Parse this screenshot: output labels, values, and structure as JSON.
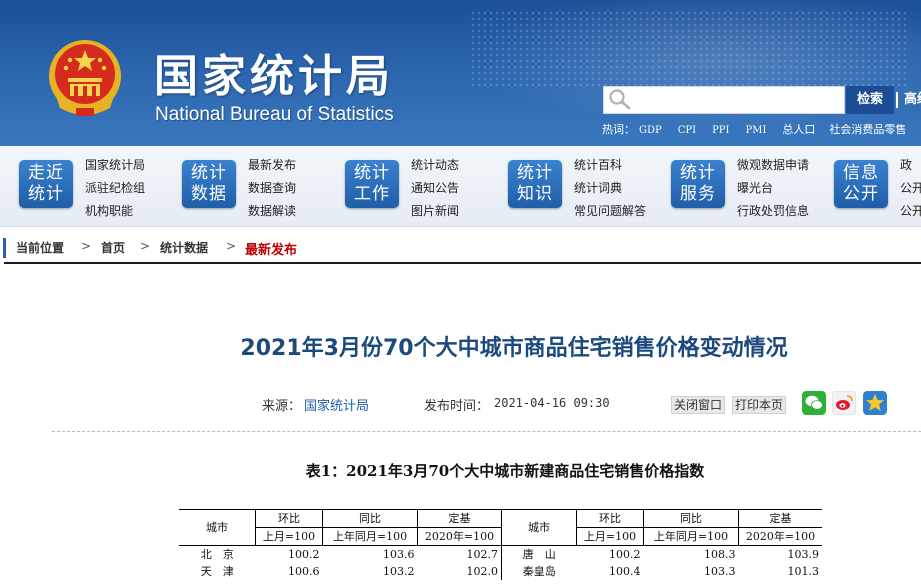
{
  "header": {
    "title_cn": "国家统计局",
    "title_en": "National Bureau of Statistics",
    "search_placeholder": "",
    "search_button": "检索",
    "advanced_search": "高级",
    "hotwords_label": "热词：",
    "hotwords": [
      "GDP",
      "CPI",
      "PPI",
      "PMI",
      "总人口",
      "社会消费品零售"
    ]
  },
  "nav": [
    {
      "tile": [
        "走近",
        "统计"
      ],
      "links": [
        "国家统计局",
        "派驻纪检组",
        "机构职能"
      ]
    },
    {
      "tile": [
        "统计",
        "数据"
      ],
      "links": [
        "最新发布",
        "数据查询",
        "数据解读"
      ]
    },
    {
      "tile": [
        "统计",
        "工作"
      ],
      "links": [
        "统计动态",
        "通知公告",
        "图片新闻"
      ]
    },
    {
      "tile": [
        "统计",
        "知识"
      ],
      "links": [
        "统计百科",
        "统计词典",
        "常见问题解答"
      ]
    },
    {
      "tile": [
        "统计",
        "服务"
      ],
      "links": [
        "微观数据申请",
        "曝光台",
        "行政处罚信息"
      ]
    },
    {
      "tile": [
        "信息",
        "公开"
      ],
      "links": [
        "政",
        "公开",
        "公开"
      ]
    }
  ],
  "breadcrumb": {
    "label": "当前位置",
    "sep": ">",
    "items": [
      "首页",
      "统计数据",
      "最新发布"
    ]
  },
  "article": {
    "title": "2021年3月份70个大中城市商品住宅销售价格变动情况",
    "source_label": "来源：",
    "source_value": "国家统计局",
    "date_label": "发布时间：",
    "date_value": "2021-04-16  09:30",
    "close_window": "关闭窗口",
    "print_page": "打印本页",
    "table_title": "表1：2021年3月70个大中城市新建商品住宅销售价格指数"
  },
  "table": {
    "city_header": "城市",
    "col_groups": [
      "环比",
      "同比",
      "定基"
    ],
    "col_bases": [
      "上月=100",
      "上年同月=100",
      "2020年=100"
    ],
    "rows": [
      {
        "left_city": "北　京",
        "left": [
          "100.2",
          "103.6",
          "102.7"
        ],
        "right_city": "唐　山",
        "right": [
          "100.2",
          "108.3",
          "103.9"
        ]
      },
      {
        "left_city": "天　津",
        "left": [
          "100.6",
          "103.2",
          "102.0"
        ],
        "right_city": "秦皇岛",
        "right": [
          "100.4",
          "103.3",
          "101.3"
        ]
      }
    ]
  },
  "colors": {
    "banner": "#2a64ad",
    "nav_tile": "#2b6fb9",
    "title": "#1d4a7d",
    "breadcrumb_current": "#c00000",
    "link": "#1c5da8"
  }
}
